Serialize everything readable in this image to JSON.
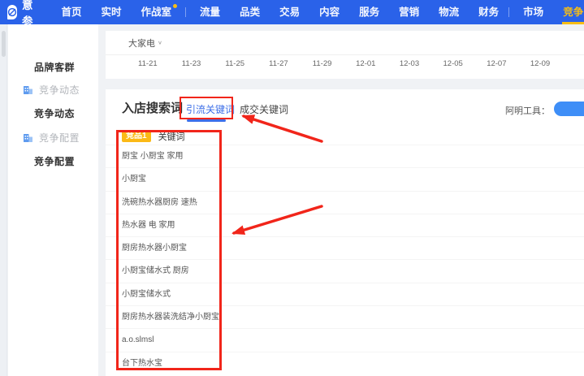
{
  "colors": {
    "nav_blue": "#2a62e9",
    "accent_yellow": "#f6bd16",
    "tab_blue": "#3d6fe8",
    "badge_yellow": "#fbb916",
    "annotation_red": "#f1251a",
    "sidebar_icon_blue": "#5e9bef",
    "tools_pill_blue": "#3e8ef7"
  },
  "nav": {
    "brand": "生意参谋",
    "items": [
      "首页",
      "实时",
      "作战室",
      "流量",
      "品类",
      "交易",
      "内容",
      "服务",
      "营销",
      "物流",
      "财务",
      "市场",
      "竞争"
    ],
    "active_item": "竞争"
  },
  "sidebar": {
    "items": [
      {
        "label": "品牌客群"
      },
      {
        "label": "竞争动态",
        "has_icon": true
      },
      {
        "label": "竞争动态"
      },
      {
        "label": "竞争配置",
        "has_icon": true
      },
      {
        "label": "竞争配置"
      }
    ]
  },
  "filter": {
    "category": "大家电",
    "chevron_icon": "∨",
    "dates": [
      "11-21",
      "11-23",
      "11-25",
      "11-27",
      "11-29",
      "12-01",
      "12-03",
      "12-05",
      "12-07",
      "12-09"
    ]
  },
  "panel": {
    "title": "入店搜索词",
    "tabs": [
      {
        "label": "引流关键词",
        "active": true
      },
      {
        "label": "成交关键词",
        "active": false
      }
    ],
    "tools_label": "阿明工具："
  },
  "table": {
    "competitor_badge": "竞品1",
    "column_header": "关键词",
    "keywords": [
      "厨宝 小厨宝 家用",
      "小厨宝",
      "洗碗热水器厨房 速热",
      "热水器 电 家用",
      "厨房热水器小厨宝",
      "小厨宝储水式 厨房",
      "小厨宝储水式",
      "厨房热水器装洗结净小厨宝",
      "a.o.slmsl",
      "台下热水宝"
    ]
  }
}
